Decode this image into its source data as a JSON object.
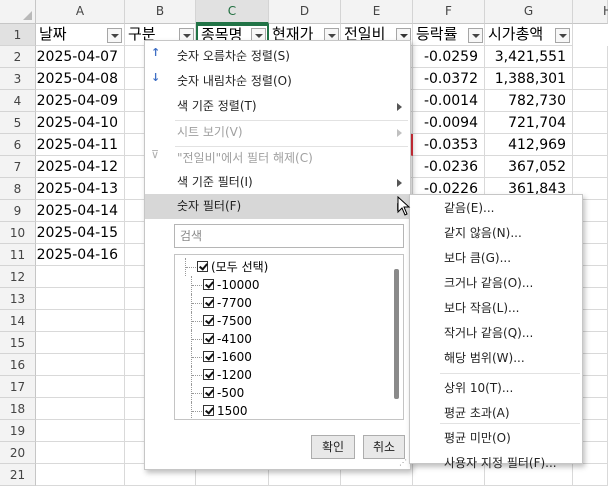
{
  "columns": [
    "A",
    "B",
    "C",
    "D",
    "E",
    "F",
    "G",
    "H"
  ],
  "row_numbers": [
    "1",
    "2",
    "3",
    "4",
    "5",
    "6",
    "7",
    "8",
    "9",
    "10",
    "11",
    "12",
    "13",
    "14",
    "15",
    "16",
    "17",
    "18",
    "19",
    "20",
    "21"
  ],
  "headers": {
    "date": "날짜",
    "type": "구분",
    "stock": "종목명",
    "price": "현재가",
    "prev": "전일비",
    "rate": "등락률",
    "cap": "시가총액"
  },
  "rows": [
    {
      "date": "2025-04-07",
      "rate": "-0.0259",
      "cap": "3,421,551"
    },
    {
      "date": "2025-04-08",
      "rate": "-0.0372",
      "cap": "1,388,301"
    },
    {
      "date": "2025-04-09",
      "rate": "-0.0014",
      "cap": "782,730"
    },
    {
      "date": "2025-04-10",
      "rate": "-0.0094",
      "cap": "721,704"
    },
    {
      "date": "2025-04-11",
      "rate": "-0.0353",
      "cap": "412,969"
    },
    {
      "date": "2025-04-12",
      "rate": "-0.0236",
      "cap": "367,052"
    },
    {
      "date": "2025-04-13",
      "rate": "-0.0226",
      "cap": "361,843"
    },
    {
      "date": "2025-04-14"
    },
    {
      "date": "2025-04-15"
    },
    {
      "date": "2025-04-16"
    }
  ],
  "menu": {
    "sort_asc": "숫자 오름차순 정렬(S)",
    "sort_desc": "숫자 내림차순 정렬(O)",
    "sort_color": "색 기준 정렬(T)",
    "sheet_view": "시트 보기(V)",
    "clear_filter": "\"전일비\"에서 필터 해제(C)",
    "color_filter": "색 기준 필터(I)",
    "number_filter": "숫자 필터(F)",
    "search_placeholder": "검색",
    "list": [
      "(모두 선택)",
      "-10000",
      "-7700",
      "-7500",
      "-4100",
      "-1600",
      "-1200",
      "-500",
      "1500"
    ],
    "ok": "확인",
    "cancel": "취소"
  },
  "submenu": [
    "같음(E)...",
    "같지 않음(N)...",
    "보다 큼(G)...",
    "크거나 같음(O)...",
    "보다 작음(L)...",
    "작거나 같음(Q)...",
    "해당 범위(W)...",
    "상위 10(T)...",
    "평균 초과(A)",
    "평균 미만(O)",
    "사용자 지정 필터(F)..."
  ],
  "colors": {
    "accent": "#217346",
    "selected_header_bg": "#e1e1e1",
    "highlight": "#d7d7d7"
  }
}
